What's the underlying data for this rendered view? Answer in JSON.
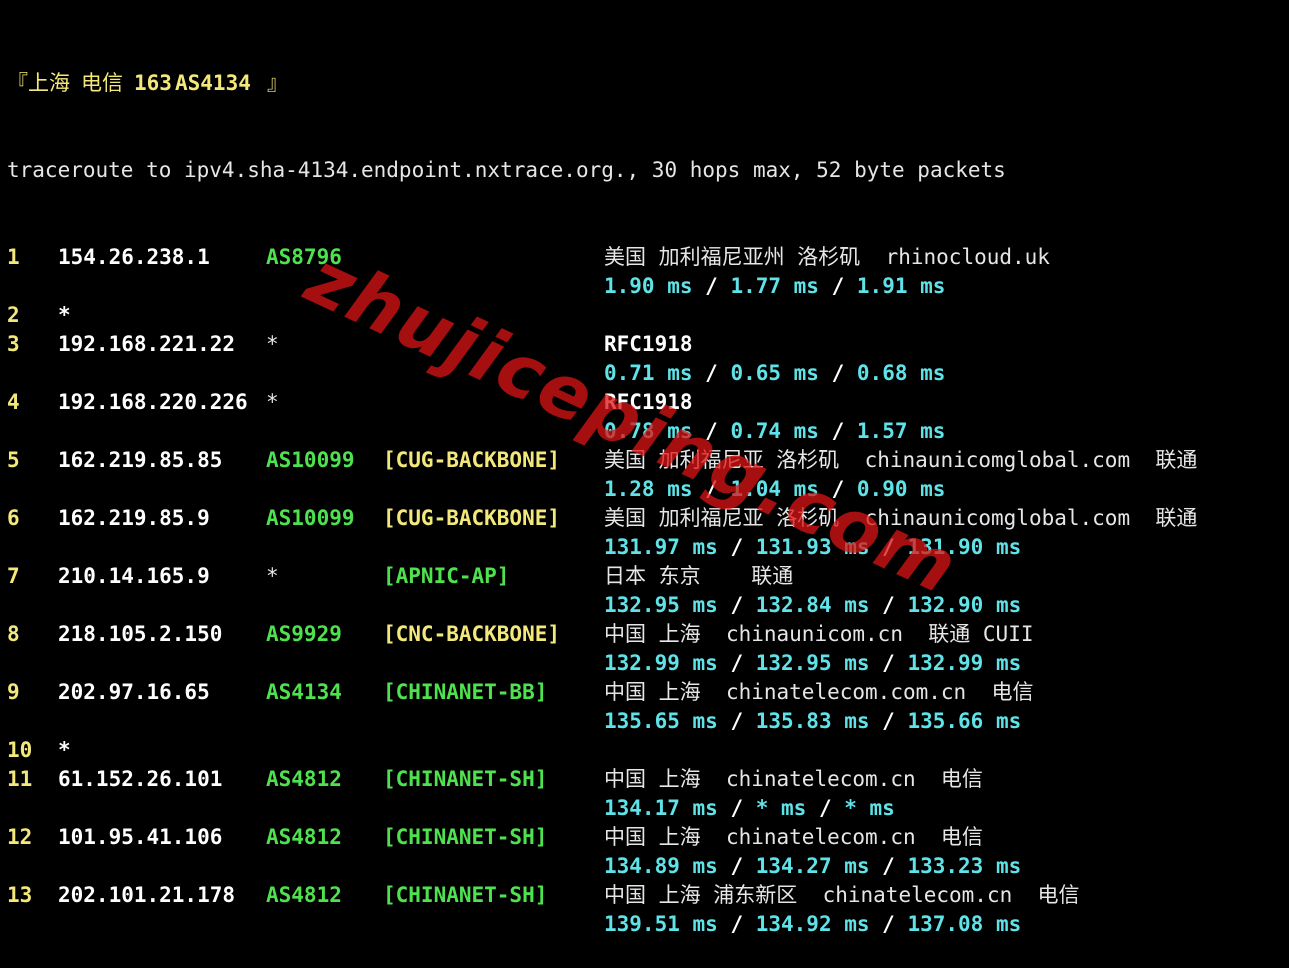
{
  "header": {
    "open": "『",
    "city": "上海",
    "isp": "电信",
    "code": "163",
    "asn": "AS4134",
    "close": "』"
  },
  "command": "traceroute to ipv4.sha-4134.endpoint.nxtrace.org., 30 hops max, 52 byte packets",
  "hops": [
    {
      "n": "1",
      "ip": "154.26.238.1",
      "asn": "AS8796",
      "tag": "",
      "geo": "美国 加利福尼亚州 洛杉矶",
      "host": "rhinocloud.uk",
      "owner": "",
      "rtt": [
        "1.90 ms",
        "1.77 ms",
        "1.91 ms"
      ]
    },
    {
      "n": "2",
      "ip": "*"
    },
    {
      "n": "3",
      "ip": "192.168.221.22",
      "asn": "*",
      "tag": "",
      "geo": "RFC1918",
      "host": "",
      "owner": "",
      "rtt": [
        "0.71 ms",
        "0.65 ms",
        "0.68 ms"
      ]
    },
    {
      "n": "4",
      "ip": "192.168.220.226",
      "asn": "*",
      "tag": "",
      "geo": "RFC1918",
      "host": "",
      "owner": "",
      "rtt": [
        "0.78 ms",
        "0.74 ms",
        "1.57 ms"
      ]
    },
    {
      "n": "5",
      "ip": "162.219.85.85",
      "asn": "AS10099",
      "tag": "[CUG-BACKBONE]",
      "geo": "美国 加利福尼亚 洛杉矶",
      "host": "chinaunicomglobal.com",
      "owner": "联通",
      "rtt": [
        "1.28 ms",
        "1.04 ms",
        "0.90 ms"
      ]
    },
    {
      "n": "6",
      "ip": "162.219.85.9",
      "asn": "AS10099",
      "tag": "[CUG-BACKBONE]",
      "geo": "美国 加利福尼亚 洛杉矶",
      "host": "chinaunicomglobal.com",
      "owner": "联通",
      "rtt": [
        "131.97 ms",
        "131.93 ms",
        "131.90 ms"
      ]
    },
    {
      "n": "7",
      "ip": "210.14.165.9",
      "asn": "*",
      "tag": "[APNIC-AP]",
      "geo": "日本 东京",
      "host": "",
      "owner": "联通",
      "rtt": [
        "132.95 ms",
        "132.84 ms",
        "132.90 ms"
      ]
    },
    {
      "n": "8",
      "ip": "218.105.2.150",
      "asn": "AS9929",
      "tag": "[CNC-BACKBONE]",
      "geo": "中国 上海",
      "host": "chinaunicom.cn",
      "owner": "联通 CUII",
      "rtt": [
        "132.99 ms",
        "132.95 ms",
        "132.99 ms"
      ]
    },
    {
      "n": "9",
      "ip": "202.97.16.65",
      "asn": "AS4134",
      "tag": "[CHINANET-BB]",
      "geo": "中国 上海",
      "host": "chinatelecom.com.cn",
      "owner": "电信",
      "rtt": [
        "135.65 ms",
        "135.83 ms",
        "135.66 ms"
      ]
    },
    {
      "n": "10",
      "ip": "*"
    },
    {
      "n": "11",
      "ip": "61.152.26.101",
      "asn": "AS4812",
      "tag": "[CHINANET-SH]",
      "geo": "中国 上海",
      "host": "chinatelecom.cn",
      "owner": "电信",
      "rtt": [
        "134.17 ms",
        "* ms",
        "* ms"
      ]
    },
    {
      "n": "12",
      "ip": "101.95.41.106",
      "asn": "AS4812",
      "tag": "[CHINANET-SH]",
      "geo": "中国 上海",
      "host": "chinatelecom.cn",
      "owner": "电信",
      "rtt": [
        "134.89 ms",
        "134.27 ms",
        "133.23 ms"
      ]
    },
    {
      "n": "13",
      "ip": "202.101.21.178",
      "asn": "AS4812",
      "tag": "[CHINANET-SH]",
      "geo": "中国 上海 浦东新区",
      "host": "chinatelecom.cn",
      "owner": "电信",
      "rtt": [
        "139.51 ms",
        "134.92 ms",
        "137.08 ms"
      ]
    }
  ],
  "separator": " / ",
  "watermark": "zhujiceping.com",
  "colors": {
    "background": "#000000",
    "hop_number": "#f3e97a",
    "ip": "#ffffff",
    "asn": "#4fe24f",
    "tag_backbone": "#f3e97a",
    "tag_regional": "#4fe24f",
    "rtt": "#5fe3e8",
    "text": "#e6e6e6",
    "watermark": "#dc1414"
  }
}
